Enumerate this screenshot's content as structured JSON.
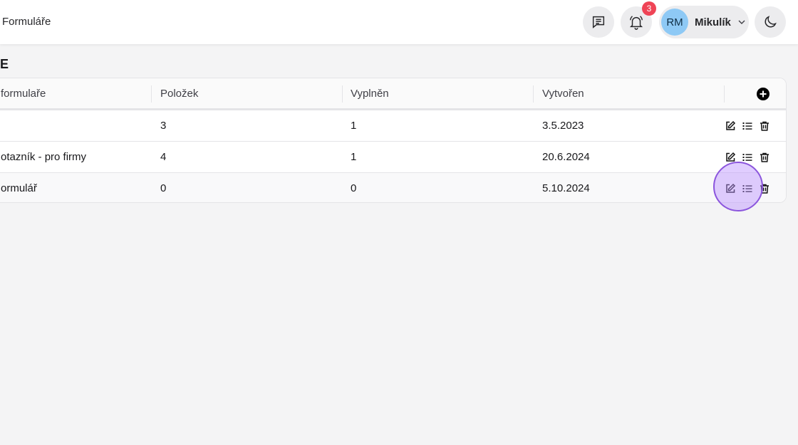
{
  "header": {
    "breadcrumb": "Formuláře",
    "notifications_count": "3",
    "user_initials": "RM",
    "user_name": "Mikulík"
  },
  "page": {
    "title": "E"
  },
  "table": {
    "columns": [
      "formulaře",
      "Položek",
      "Vyplněn",
      "Vytvořen"
    ],
    "rows": [
      {
        "name": "",
        "items": "3",
        "filled": "1",
        "created": "3.5.2023"
      },
      {
        "name": "otazník - pro firmy",
        "items": "4",
        "filled": "1",
        "created": "20.6.2024"
      },
      {
        "name": "ormulář",
        "items": "0",
        "filled": "0",
        "created": "5.10.2024"
      }
    ]
  },
  "colors": {
    "accent_badge": "#ef4456",
    "avatar": "#8ec9f5",
    "cursor": "#8b55dd"
  }
}
